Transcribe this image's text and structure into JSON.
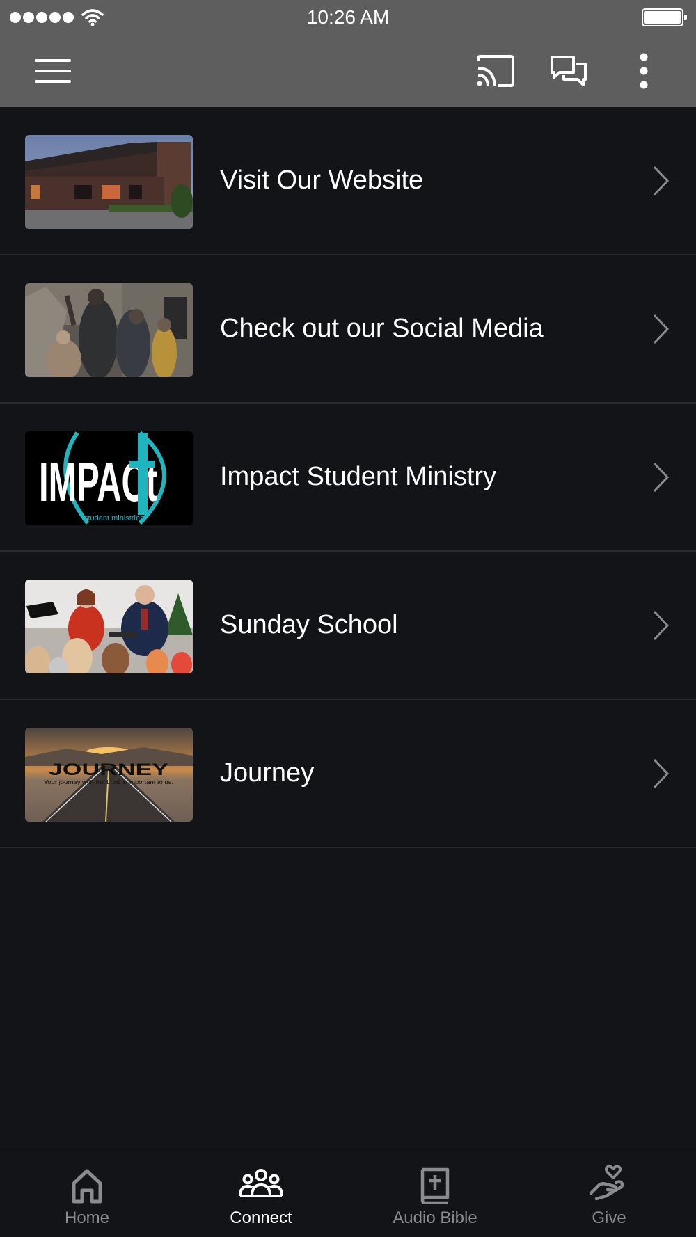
{
  "status_bar": {
    "time": "10:26 AM",
    "signal_icon": "signal-dots-icon",
    "wifi_icon": "wifi-icon",
    "battery_icon": "battery-icon"
  },
  "app_bar": {
    "menu_icon": "hamburger-menu-icon",
    "cast_icon": "cast-icon",
    "chat_icon": "chat-bubbles-icon",
    "more_icon": "more-vertical-icon",
    "background": "#5e5e5e"
  },
  "list": {
    "items": [
      {
        "label": "Visit Our Website",
        "thumbnail": "church-building-photo",
        "chevron_icon": "chevron-right-icon"
      },
      {
        "label": "Check out our Social Media",
        "thumbnail": "worship-congregation-photo",
        "chevron_icon": "chevron-right-icon"
      },
      {
        "label": "Impact Student Ministry",
        "thumbnail": "impact-logo",
        "thumbnail_text": "IMPACt",
        "thumbnail_subtext": "student ministries",
        "chevron_icon": "chevron-right-icon"
      },
      {
        "label": "Sunday School",
        "thumbnail": "sunday-school-class-photo",
        "chevron_icon": "chevron-right-icon"
      },
      {
        "label": "Journey",
        "thumbnail": "journey-road-sunset",
        "thumbnail_text": "JOURNEY",
        "thumbnail_subtext": "Your journey with the Lord is important to us.",
        "chevron_icon": "chevron-right-icon"
      }
    ]
  },
  "tab_bar": {
    "tabs": [
      {
        "label": "Home",
        "icon": "home-icon",
        "active": false
      },
      {
        "label": "Connect",
        "icon": "people-group-icon",
        "active": true
      },
      {
        "label": "Audio Bible",
        "icon": "bible-icon",
        "active": false
      },
      {
        "label": "Give",
        "icon": "giving-hand-heart-icon",
        "active": false
      }
    ]
  },
  "colors": {
    "background": "#131417",
    "header": "#5e5e5e",
    "divider": "#2a2b2f",
    "inactive_tab": "#8a8b8e",
    "impact_accent": "#1fb5c0"
  }
}
